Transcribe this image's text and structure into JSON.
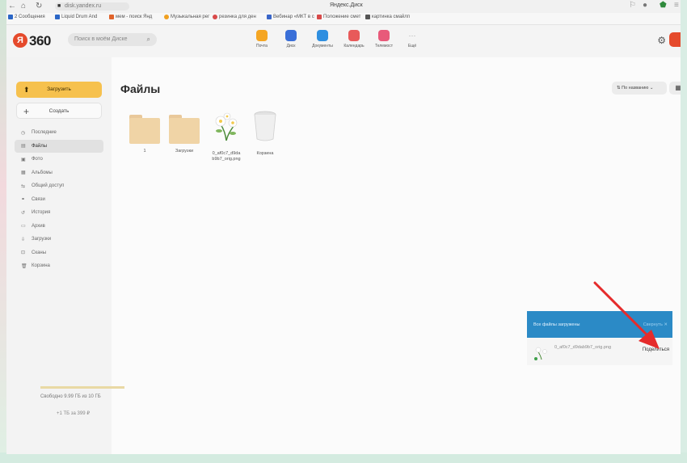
{
  "browser": {
    "url": "disk.yandex.ru",
    "page_title": "Яндекс.Диск",
    "bookmarks": [
      {
        "label": "2 Сообщения",
        "color": "#2b66c6"
      },
      {
        "label": "Liquid Drum And",
        "color": "#2b66c6"
      },
      {
        "label": "мем - поиск Янд",
        "color": "#e0632a"
      },
      {
        "label": "Музыкальная рег",
        "color": "#f0a020"
      },
      {
        "label": "резинка для ден",
        "color": "#d84a4a"
      },
      {
        "label": "Вебинар «МКТ в с",
        "color": "#3a66c9"
      },
      {
        "label": "Положение смет",
        "color": "#d84a4a"
      },
      {
        "label": "картинка смайлп",
        "color": "#555555"
      }
    ]
  },
  "header": {
    "logo_mark": "Я",
    "logo_text": "360",
    "search_placeholder": "Поиск в моём Диске",
    "services": [
      {
        "label": "Почта",
        "color": "#f5a623",
        "icon": "mail-icon"
      },
      {
        "label": "Диск",
        "color": "#3a6fd8",
        "icon": "disk-icon"
      },
      {
        "label": "Документы",
        "color": "#2f8fe0",
        "icon": "documents-icon"
      },
      {
        "label": "Календарь",
        "color": "#e85a5a",
        "icon": "calendar-icon"
      },
      {
        "label": "Телемост",
        "color": "#e85a7a",
        "icon": "telemost-icon"
      },
      {
        "label": "Ещё",
        "color": "#f4f4f4",
        "icon": "more-icon"
      }
    ]
  },
  "sidebar": {
    "upload_label": "Загрузить",
    "create_label": "Создать",
    "items": [
      {
        "label": "Последние",
        "icon": "clock-icon",
        "glyph": "◷"
      },
      {
        "label": "Файлы",
        "icon": "files-icon",
        "glyph": "▤",
        "active": true
      },
      {
        "label": "Фото",
        "icon": "photo-icon",
        "glyph": "▣"
      },
      {
        "label": "Альбомы",
        "icon": "albums-icon",
        "glyph": "▦"
      },
      {
        "label": "Общий доступ",
        "icon": "share-icon",
        "glyph": "⇆"
      },
      {
        "label": "Связи",
        "icon": "links-icon",
        "glyph": "⚭"
      },
      {
        "label": "История",
        "icon": "history-icon",
        "glyph": "↺"
      },
      {
        "label": "Архив",
        "icon": "archive-icon",
        "glyph": "▭"
      },
      {
        "label": "Загрузки",
        "icon": "downloads-icon",
        "glyph": "⇩"
      },
      {
        "label": "Сканы",
        "icon": "scans-icon",
        "glyph": "⊡"
      },
      {
        "label": "Корзина",
        "icon": "trash-icon",
        "glyph": "🗑"
      }
    ],
    "quota_text": "Свободно 9.99 ГБ из 10 ГБ",
    "buy_text": "+1 ТБ за 399 ₽"
  },
  "main": {
    "title": "Файлы",
    "sort_label": "По названию",
    "files": [
      {
        "label": "1",
        "type": "folder"
      },
      {
        "label": "Загрузки",
        "type": "folder"
      },
      {
        "label": "0_af0c7_d9da b9b7_orig.png",
        "type": "image"
      },
      {
        "label": "Корзина",
        "type": "trash"
      }
    ]
  },
  "upload_panel": {
    "title": "Все файлы загружены",
    "collapse_label": "Свернуть",
    "close_glyph": "✕",
    "file_name": "0_af0c7_d9dab9b7_orig.png",
    "file_size": "",
    "share_label": "Поделиться"
  },
  "colors": {
    "accent_yellow": "#f6c14e",
    "panel_blue": "#2b8ac6",
    "logo_red": "#e54a2c",
    "arrow_red": "#e52b2b"
  }
}
